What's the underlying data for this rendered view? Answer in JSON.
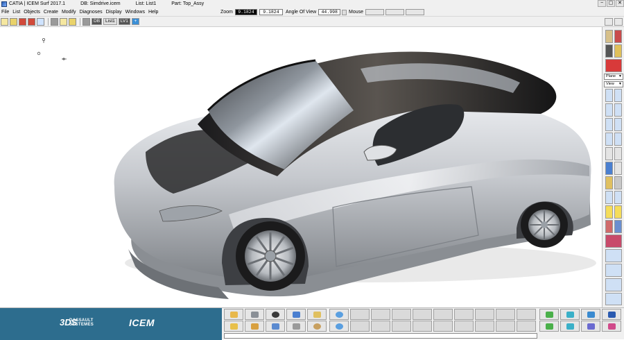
{
  "titlebar": {
    "app": "CATIA | ICEM Surf 2017.1",
    "db": "DB: Simdrive.icem",
    "list": "List: List1",
    "part": "Part: Top_Assy",
    "minimize": "−",
    "restore": "▢",
    "close": "✕"
  },
  "menu": [
    "File",
    "List",
    "Objects",
    "Create",
    "Modify",
    "Diagnoses",
    "Display",
    "Windows",
    "Help"
  ],
  "status": {
    "zoom_label": "Zoom",
    "zoom_value": "9.1824",
    "zoom_value2": "9.1824",
    "angle_label": "Angle Of View",
    "angle_value": "44.998",
    "mouse_label": "Mouse"
  },
  "toolbar": {
    "db_tag": "DB",
    "list_tag": "List1",
    "lv_tag": "LV1",
    "add_tag": "+"
  },
  "sidebar": {
    "plane_select": "Plane",
    "view_select": "View"
  },
  "brand": {
    "ds_mark": "3DS",
    "ds_text_1": "DASSAULT",
    "ds_text_2": "SYSTEMES",
    "icem": "ICEM"
  },
  "icons": {
    "app": "catia-app-icon",
    "car_model": "car-3d-model"
  },
  "colors": {
    "brand_bg": "#2d6d8e",
    "chrome_bg": "#f0f0f0",
    "car_body": "#c9ccd1"
  }
}
